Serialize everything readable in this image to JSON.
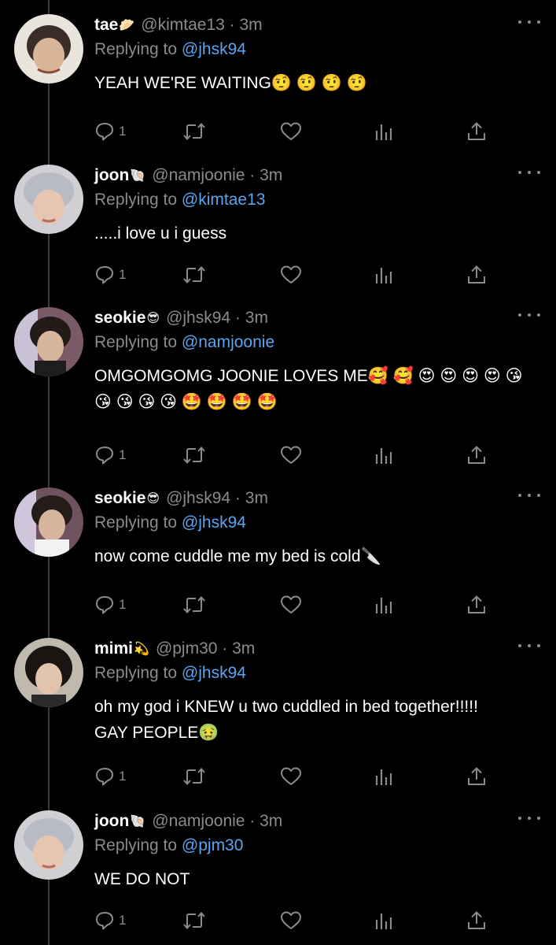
{
  "tweets": [
    {
      "name": "tae",
      "name_emoji": "🥟",
      "handle": "@kimtae13 · 3m",
      "replying_label": "Replying to",
      "replying_to": "@jhsk94",
      "text": "YEAH WE'RE WAITING🤨 🤨 🤨 🤨",
      "reply_count": "1"
    },
    {
      "name": "joon",
      "name_emoji": "🐚",
      "handle": "@namjoonie · 3m",
      "replying_label": "Replying to",
      "replying_to": "@kimtae13",
      "text": ".....i love u i guess",
      "reply_count": "1"
    },
    {
      "name": "seokie",
      "name_emoji": "😎",
      "handle": "@jhsk94 · 3m",
      "replying_label": "Replying to",
      "replying_to": "@namjoonie",
      "text": "OMGOMGOMG JOONIE LOVES ME🥰 🥰 😍 😍 😍 😍 😘\n😘 😘 😘 😘 🤩 🤩 🤩 🤩",
      "reply_count": "1"
    },
    {
      "name": "seokie",
      "name_emoji": "😎",
      "handle": "@jhsk94 · 3m",
      "replying_label": "Replying to",
      "replying_to": "@jhsk94",
      "text": "now come cuddle me my bed is cold🔪",
      "reply_count": "1"
    },
    {
      "name": "mimi",
      "name_emoji": "💫",
      "handle": "@pjm30 · 3m",
      "replying_label": "Replying to",
      "replying_to": "@jhsk94",
      "text": "oh my god i KNEW u two cuddled in bed together!!!!!\nGAY PEOPLE🤢",
      "reply_count": "1"
    },
    {
      "name": "joon",
      "name_emoji": "🐚",
      "handle": "@namjoonie · 3m",
      "replying_label": "Replying to",
      "replying_to": "@pjm30",
      "text": "WE DO NOT",
      "reply_count": "1"
    }
  ],
  "icons": {
    "reply": "reply-icon",
    "retweet": "retweet-icon",
    "like": "heart-icon",
    "stats": "stats-icon",
    "share": "share-icon",
    "more": "more-options-icon"
  },
  "colors": {
    "background": "#000000",
    "text": "#ffffff",
    "secondary": "#8b8b8b",
    "mention": "#5aa5f0"
  }
}
